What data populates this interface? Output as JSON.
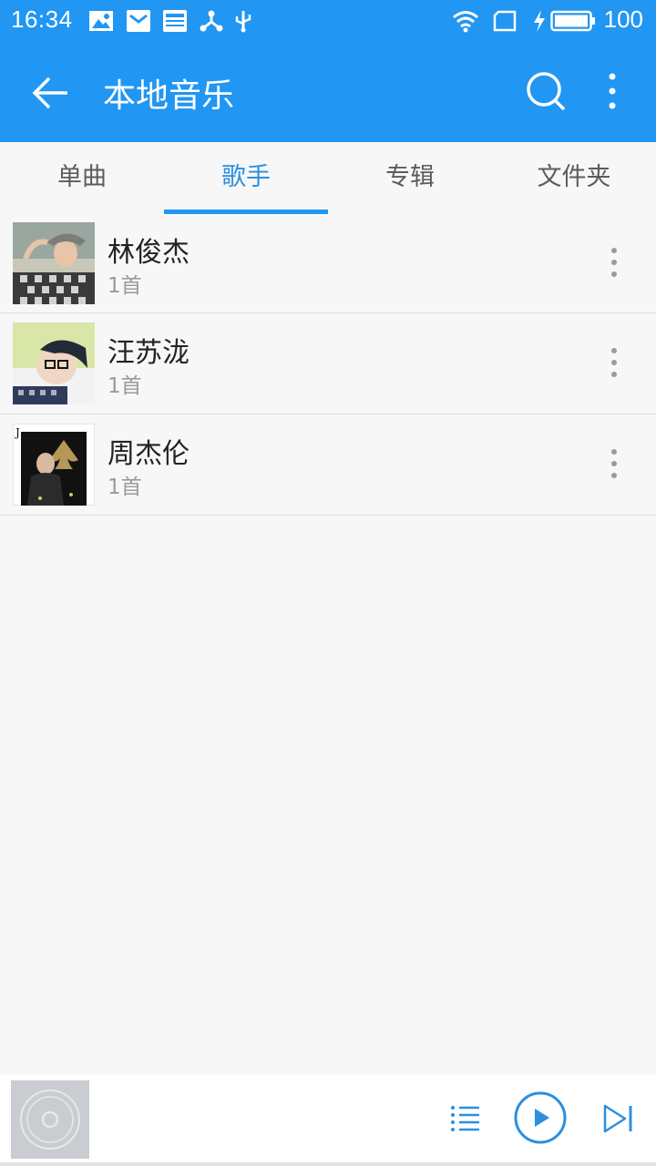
{
  "status_bar": {
    "time": "16:34",
    "battery": "100",
    "icons": [
      "image-icon",
      "mail-icon",
      "news-icon",
      "share-icon",
      "usb-icon",
      "wifi-icon",
      "sim-icon",
      "charging-icon",
      "battery-icon"
    ]
  },
  "app_bar": {
    "title": "本地音乐",
    "back_icon": "back-arrow-icon",
    "search_icon": "search-icon",
    "more_icon": "more-vertical-icon",
    "color": "#2196f3"
  },
  "tabs": [
    {
      "label": "单曲",
      "active": false
    },
    {
      "label": "歌手",
      "active": true
    },
    {
      "label": "专辑",
      "active": false
    },
    {
      "label": "文件夹",
      "active": false
    }
  ],
  "artists": [
    {
      "name": "林俊杰",
      "count": "1首"
    },
    {
      "name": "汪苏泷",
      "count": "1首"
    },
    {
      "name": "周杰伦",
      "count": "1首"
    }
  ],
  "player": {
    "art_icon": "disc-placeholder-icon",
    "controls": [
      "playlist-icon",
      "play-icon",
      "next-icon"
    ],
    "accent": "#2b8fe0"
  }
}
